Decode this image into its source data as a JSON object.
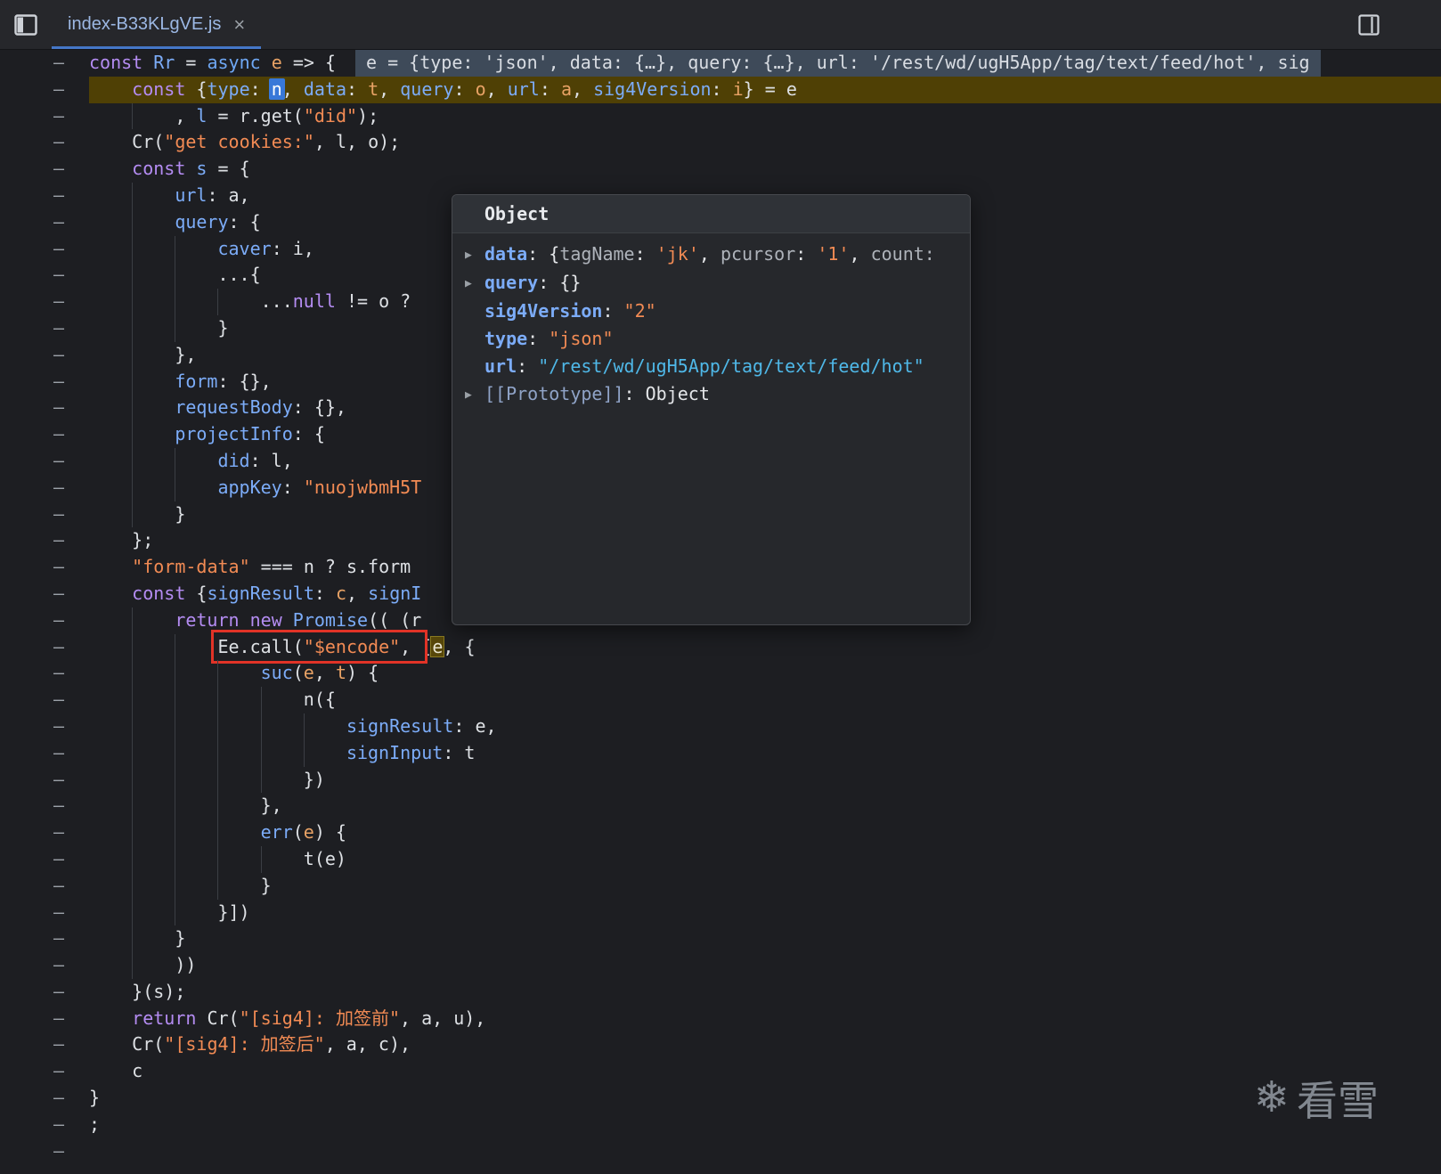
{
  "colors": {
    "tab_underline": "#4577c8",
    "exec_line_bg": "#4f4005",
    "red_annotation": "#e13327",
    "token_selection_blue": "#3878d8",
    "token_highlight_olive": "#57470a",
    "string_orange": "#f28b54",
    "property_blue": "#7cacf8",
    "keyword_purple": "#b48cf2",
    "popup_url_cyan": "#4fb8e8"
  },
  "tabbar": {
    "tab": {
      "title": "index-B33KLgVE.js",
      "close": "×"
    },
    "left_icon": "panel-left",
    "right_icon": "panel-right"
  },
  "editor": {
    "gutter_symbol": "–",
    "lines": [
      {
        "ind": 0,
        "segs": [
          [
            "const ",
            "kw"
          ],
          [
            "Rr ",
            "def2"
          ],
          [
            "= ",
            "pl"
          ],
          [
            "async ",
            "kw2"
          ],
          [
            "e ",
            "def"
          ],
          [
            "=> {",
            "pl"
          ]
        ],
        "widget": "e = {type: 'json', data: {…}, query: {…}, url: '/rest/wd/ugH5App/tag/text/feed/hot', sig"
      },
      {
        "ind": 1,
        "exec": true,
        "segs": [
          [
            "const ",
            "kw"
          ],
          [
            "{",
            "pl"
          ],
          [
            "type",
            "prop"
          ],
          [
            ": ",
            "pl"
          ],
          [
            "n",
            "hln"
          ],
          [
            ", ",
            "pl"
          ],
          [
            "data",
            "prop"
          ],
          [
            ": ",
            "pl"
          ],
          [
            "t",
            "def"
          ],
          [
            ", ",
            "pl"
          ],
          [
            "query",
            "prop"
          ],
          [
            ": ",
            "pl"
          ],
          [
            "o",
            "def"
          ],
          [
            ", ",
            "pl"
          ],
          [
            "url",
            "prop"
          ],
          [
            ": ",
            "pl"
          ],
          [
            "a",
            "def"
          ],
          [
            ", ",
            "pl"
          ],
          [
            "sig4Version",
            "prop"
          ],
          [
            ": ",
            "pl"
          ],
          [
            "i",
            "def"
          ],
          [
            "} = e",
            "pl"
          ]
        ]
      },
      {
        "ind": 2,
        "segs": [
          [
            ", ",
            "pl"
          ],
          [
            "l ",
            "def2"
          ],
          [
            "= r.get(",
            "pl"
          ],
          [
            "\"did\"",
            "str"
          ],
          [
            ");",
            "pl"
          ]
        ]
      },
      {
        "ind": 1,
        "segs": [
          [
            "Cr(",
            "pl"
          ],
          [
            "\"get cookies:\"",
            "str"
          ],
          [
            ", l, o);",
            "pl"
          ]
        ]
      },
      {
        "ind": 1,
        "segs": [
          [
            "const ",
            "kw"
          ],
          [
            "s ",
            "def2"
          ],
          [
            "= {",
            "pl"
          ]
        ]
      },
      {
        "ind": 2,
        "segs": [
          [
            "url",
            "prop"
          ],
          [
            ": a,",
            "pl"
          ]
        ]
      },
      {
        "ind": 2,
        "segs": [
          [
            "query",
            "prop"
          ],
          [
            ": {",
            "pl"
          ]
        ]
      },
      {
        "ind": 3,
        "segs": [
          [
            "caver",
            "prop"
          ],
          [
            ": i,",
            "pl"
          ]
        ]
      },
      {
        "ind": 3,
        "segs": [
          [
            "...{",
            "pl"
          ]
        ]
      },
      {
        "ind": 4,
        "segs": [
          [
            "...",
            "pl"
          ],
          [
            "null ",
            "kw"
          ],
          [
            "!= o ?",
            "pl"
          ]
        ]
      },
      {
        "ind": 3,
        "segs": [
          [
            "}",
            "pl"
          ]
        ]
      },
      {
        "ind": 2,
        "segs": [
          [
            "},",
            "pl"
          ]
        ]
      },
      {
        "ind": 2,
        "segs": [
          [
            "form",
            "prop"
          ],
          [
            ": {},",
            "pl"
          ]
        ]
      },
      {
        "ind": 2,
        "segs": [
          [
            "requestBody",
            "prop"
          ],
          [
            ": {},",
            "pl"
          ]
        ]
      },
      {
        "ind": 2,
        "segs": [
          [
            "projectInfo",
            "prop"
          ],
          [
            ": {",
            "pl"
          ]
        ]
      },
      {
        "ind": 3,
        "segs": [
          [
            "did",
            "prop"
          ],
          [
            ": l,",
            "pl"
          ]
        ]
      },
      {
        "ind": 3,
        "segs": [
          [
            "appKey",
            "prop"
          ],
          [
            ": ",
            "pl"
          ],
          [
            "\"nuojwbmH5T",
            "str"
          ]
        ]
      },
      {
        "ind": 2,
        "segs": [
          [
            "}",
            "pl"
          ]
        ]
      },
      {
        "ind": 1,
        "segs": [
          [
            "};",
            "pl"
          ]
        ]
      },
      {
        "ind": 1,
        "segs": [
          [
            "\"form-data\"",
            "str"
          ],
          [
            " === n ? s.form",
            "pl"
          ]
        ]
      },
      {
        "ind": 1,
        "segs": [
          [
            "const ",
            "kw"
          ],
          [
            "{",
            "pl"
          ],
          [
            "signResult",
            "prop"
          ],
          [
            ": ",
            "pl"
          ],
          [
            "c",
            "def"
          ],
          [
            ", ",
            "pl"
          ],
          [
            "signI",
            "prop"
          ]
        ]
      },
      {
        "ind": 2,
        "segs": [
          [
            "return ",
            "kw"
          ],
          [
            "new ",
            "kw"
          ],
          [
            "Promise",
            "def2"
          ],
          [
            "(( (r",
            "pl"
          ]
        ]
      },
      {
        "ind": 3,
        "segs": [
          [
            "Ee.call(",
            "pl",
            "red"
          ],
          [
            "\"$encode\"",
            "str",
            "red"
          ],
          [
            ", ",
            "pl",
            "red"
          ],
          [
            "[",
            "pl"
          ],
          [
            "e",
            "hle"
          ],
          [
            ", {",
            "pl"
          ]
        ]
      },
      {
        "ind": 4,
        "segs": [
          [
            "suc",
            "prop"
          ],
          [
            "(",
            "pl"
          ],
          [
            "e",
            "def"
          ],
          [
            ", ",
            "pl"
          ],
          [
            "t",
            "def"
          ],
          [
            ") {",
            "pl"
          ]
        ]
      },
      {
        "ind": 5,
        "segs": [
          [
            "n({",
            "pl"
          ]
        ]
      },
      {
        "ind": 6,
        "segs": [
          [
            "signResult",
            "prop"
          ],
          [
            ": e,",
            "pl"
          ]
        ]
      },
      {
        "ind": 6,
        "segs": [
          [
            "signInput",
            "prop"
          ],
          [
            ": t",
            "pl"
          ]
        ]
      },
      {
        "ind": 5,
        "segs": [
          [
            "})",
            "pl"
          ]
        ]
      },
      {
        "ind": 4,
        "segs": [
          [
            "},",
            "pl"
          ]
        ]
      },
      {
        "ind": 4,
        "segs": [
          [
            "err",
            "prop"
          ],
          [
            "(",
            "pl"
          ],
          [
            "e",
            "def"
          ],
          [
            ") {",
            "pl"
          ]
        ]
      },
      {
        "ind": 5,
        "segs": [
          [
            "t(e)",
            "pl"
          ]
        ]
      },
      {
        "ind": 4,
        "segs": [
          [
            "}",
            "pl"
          ]
        ]
      },
      {
        "ind": 3,
        "segs": [
          [
            "}])",
            "pl"
          ]
        ]
      },
      {
        "ind": 2,
        "segs": [
          [
            "}",
            "pl"
          ]
        ]
      },
      {
        "ind": 2,
        "segs": [
          [
            "))",
            "pl"
          ]
        ]
      },
      {
        "ind": 1,
        "segs": [
          [
            "}(s);",
            "pl"
          ]
        ]
      },
      {
        "ind": 1,
        "segs": [
          [
            "return ",
            "kw"
          ],
          [
            "Cr(",
            "pl"
          ],
          [
            "\"[sig4]: 加签前\"",
            "str"
          ],
          [
            ", a, u),",
            "pl"
          ]
        ]
      },
      {
        "ind": 1,
        "segs": [
          [
            "Cr(",
            "pl"
          ],
          [
            "\"[sig4]: 加签后\"",
            "str"
          ],
          [
            ", a, c),",
            "pl"
          ]
        ]
      },
      {
        "ind": 1,
        "segs": [
          [
            "c",
            "pl"
          ]
        ]
      },
      {
        "ind": 0,
        "segs": [
          [
            "}",
            "pl"
          ]
        ]
      },
      {
        "ind": 0,
        "segs": [
          [
            ";",
            "pl"
          ]
        ]
      },
      {
        "ind": 0,
        "segs": []
      }
    ]
  },
  "popup": {
    "title": "Object",
    "rows": [
      {
        "arrow": true,
        "name": "data",
        "segs": [
          [
            "{",
            "pv"
          ],
          [
            "tagName",
            "pk"
          ],
          [
            ": ",
            "pv"
          ],
          [
            "'jk'",
            "ps"
          ],
          [
            ", ",
            "pv"
          ],
          [
            "pcursor",
            "pk"
          ],
          [
            ": ",
            "pv"
          ],
          [
            "'1'",
            "ps"
          ],
          [
            ", ",
            "pv"
          ],
          [
            "count:",
            "pk"
          ]
        ]
      },
      {
        "arrow": true,
        "name": "query",
        "segs": [
          [
            "{}",
            "pv"
          ]
        ]
      },
      {
        "arrow": false,
        "name": "sig4Version",
        "segs": [
          [
            "\"2\"",
            "ps"
          ]
        ]
      },
      {
        "arrow": false,
        "name": "type",
        "segs": [
          [
            "\"json\"",
            "ps"
          ]
        ]
      },
      {
        "arrow": false,
        "name": "url",
        "segs": [
          [
            "\"/rest/wd/ugH5App/tag/text/feed/hot\"",
            "purl"
          ]
        ]
      },
      {
        "arrow": true,
        "name": "[[Prototype]]",
        "name_cls": "proto",
        "segs": [
          [
            "Object",
            "pv"
          ]
        ]
      }
    ]
  },
  "watermark": {
    "icon": "❄",
    "text": "看雪"
  }
}
